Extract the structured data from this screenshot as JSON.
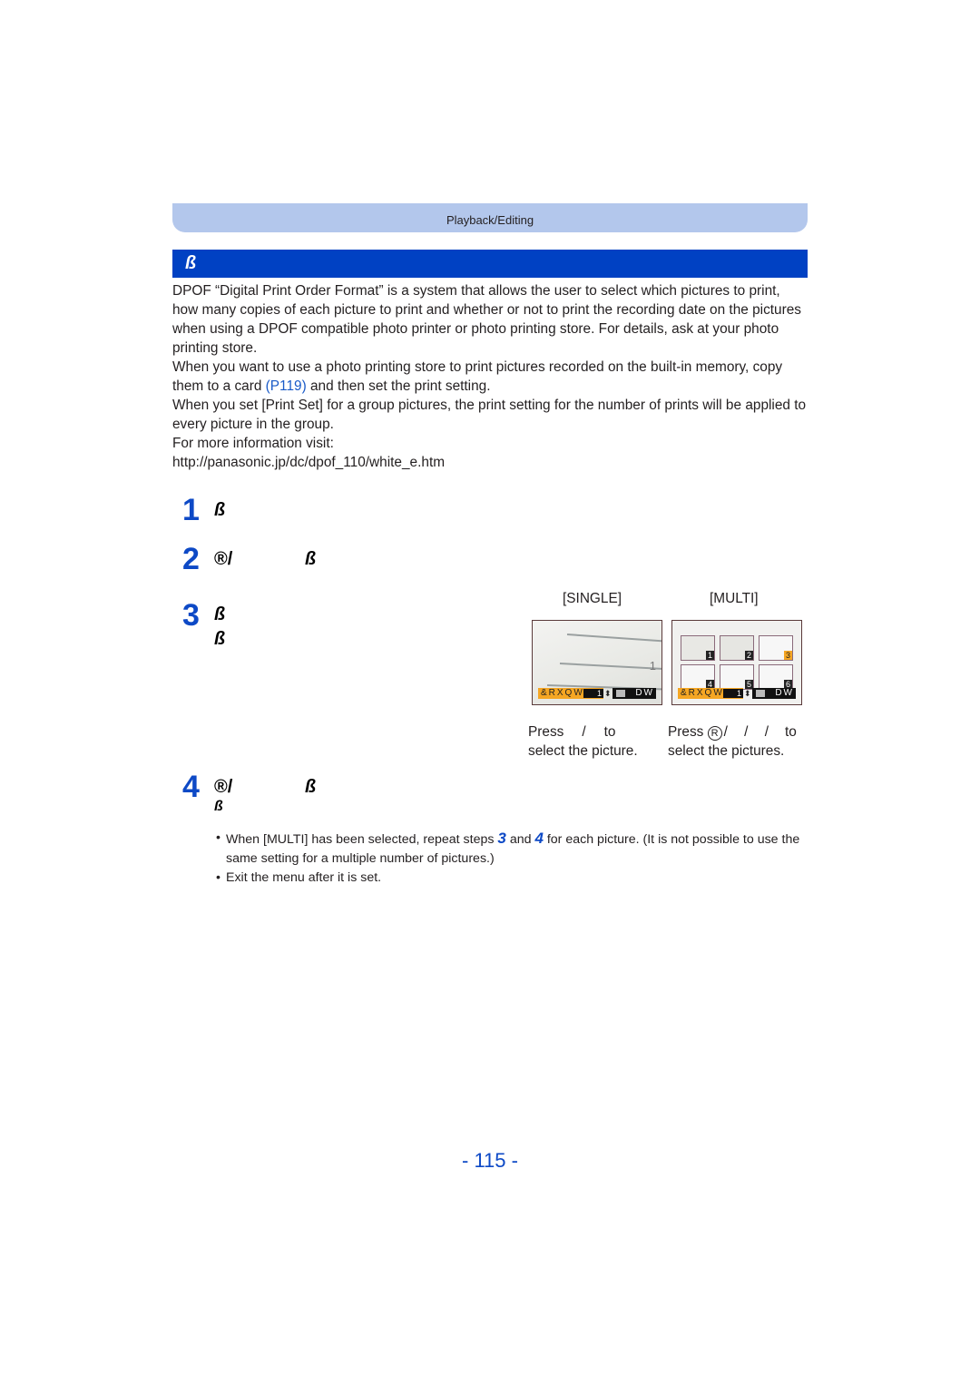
{
  "header": {
    "section_label": "Playback/Editing"
  },
  "title_bar": {
    "icon": "dpof-print-set-glyph",
    "glyph_text": "ß"
  },
  "intro": {
    "paragraphs": [
      "DPOF “Digital Print Order Format” is a system that allows the user to select which pictures to print, how many copies of each picture to print and whether or not to print the recording date on the pictures when using a DPOF compatible photo printer or photo printing store. For details, ask at your photo printing store."
    ],
    "para2_before_link": "When you want to use a photo printing store to print pictures recorded on the built-in memory, copy them to a card ",
    "para2_link": "(P119)",
    "para2_after_link": " and then set the print setting.",
    "para3": "When you set [Print Set] for a group pictures, the print setting for the number of prints will be applied to every picture in the group.",
    "para4": "For more information visit:",
    "url": "http://panasonic.jp/dc/dpof_110/white_e.htm"
  },
  "steps": [
    {
      "number": "1",
      "glyphs": [
        "ß"
      ]
    },
    {
      "number": "2",
      "glyphs": [
        "®/",
        "ß"
      ]
    },
    {
      "number": "3",
      "glyphs": [
        "ß",
        "ß"
      ]
    },
    {
      "number": "4",
      "glyphs": [
        "®/",
        "ß",
        "ß"
      ]
    }
  ],
  "modes": {
    "single": {
      "label": "[SINGLE]",
      "lcd_count_text": "&RXQW",
      "lcd_count_value": "1",
      "lcd_date_text": "DW",
      "lcd_print_icon_text": "1",
      "press_line1": "Press",
      "press_sep": "/",
      "press_to": "to",
      "press_line2": "select the picture."
    },
    "multi": {
      "label": "[MULTI]",
      "lcd_count_text": "&RXQW",
      "lcd_count_value": "1",
      "lcd_date_text": "DW",
      "thumbnails": [
        "1",
        "2",
        "3",
        "4",
        "5",
        "6"
      ],
      "selected_thumbnail": "3",
      "press_line1": "Press",
      "press_button": "R",
      "press_seps": "/ / /",
      "press_to": "to",
      "press_line2": "select the pictures."
    }
  },
  "notes": {
    "bullet1_a": "When [MULTI] has been selected, repeat steps ",
    "bullet1_step3": "3",
    "bullet1_b": " and ",
    "bullet1_step4": "4",
    "bullet1_c": " for each picture. (It is not possible to use the same setting for a multiple number of pictures.)",
    "bullet2": "Exit the menu after it is set."
  },
  "footer": {
    "page_number": "- 115 -"
  },
  "colors": {
    "accent_blue": "#0041c3",
    "header_band": "#b3c7ec",
    "step_number_blue": "#0d49c6",
    "lcd_orange": "#f5a623"
  }
}
